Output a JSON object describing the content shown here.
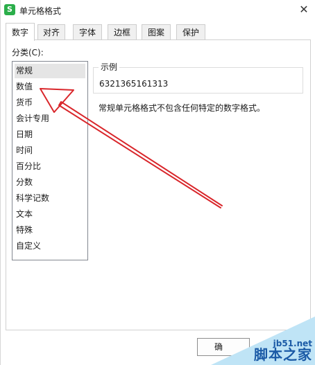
{
  "window": {
    "title": "单元格格式",
    "app_icon_letter": "S",
    "close_symbol": "✕"
  },
  "tabs": [
    {
      "label": "数字",
      "active": true
    },
    {
      "label": "对齐",
      "active": false
    },
    {
      "label": "字体",
      "active": false
    },
    {
      "label": "边框",
      "active": false
    },
    {
      "label": "图案",
      "active": false
    },
    {
      "label": "保护",
      "active": false
    }
  ],
  "category": {
    "label": "分类(C):",
    "items": [
      "常规",
      "数值",
      "货币",
      "会计专用",
      "日期",
      "时间",
      "百分比",
      "分数",
      "科学记数",
      "文本",
      "特殊",
      "自定义"
    ],
    "selected_index": 0
  },
  "sample": {
    "title": "示例",
    "value": "6321365161313"
  },
  "description": "常规单元格格式不包含任何特定的数字格式。",
  "buttons": {
    "ok_label": "确"
  },
  "annotation": {
    "arrow_color": "#d9262b"
  },
  "watermark": {
    "site": "jb51.net",
    "name": "脚本之家"
  }
}
